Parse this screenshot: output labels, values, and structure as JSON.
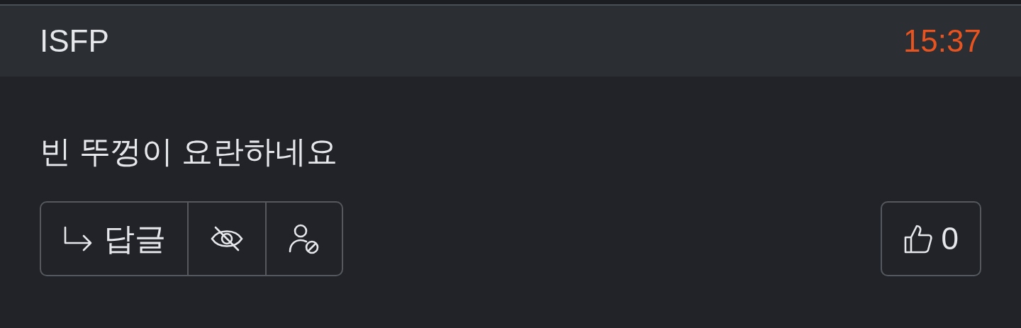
{
  "header": {
    "author": "ISFP",
    "time": "15:37"
  },
  "comment": {
    "text": "빈 뚜껑이 요란하네요"
  },
  "actions": [
    {
      "kind": "reply",
      "label": "답글"
    },
    {
      "kind": "hide"
    },
    {
      "kind": "block"
    }
  ],
  "like": {
    "count": "0"
  }
}
